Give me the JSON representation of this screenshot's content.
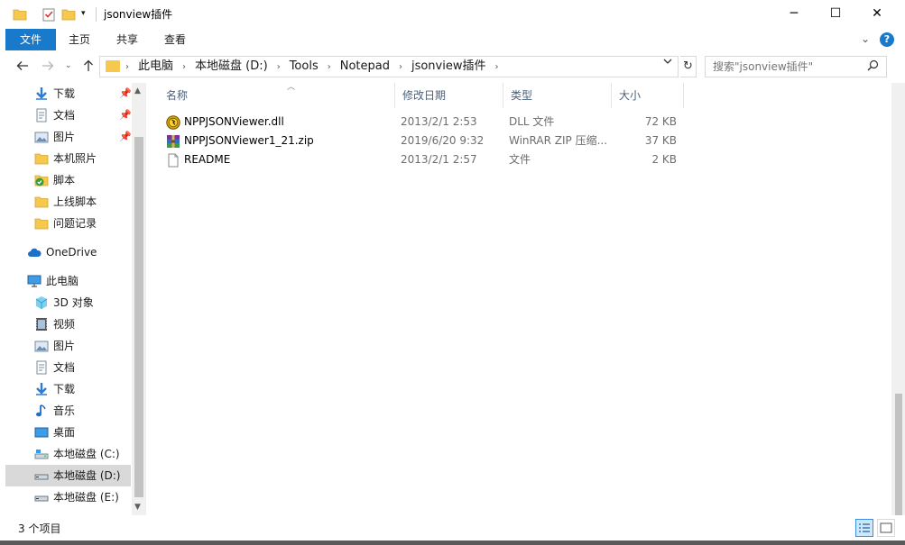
{
  "window": {
    "title": "jsonview插件",
    "minimize_glyph": "─",
    "maximize_glyph": "☐",
    "close_glyph": "✕"
  },
  "ribbon": {
    "tabs": [
      "文件",
      "主页",
      "共享",
      "查看"
    ],
    "expand_glyph": "⌄",
    "help_glyph": "?"
  },
  "address": {
    "breadcrumbs": [
      "此电脑",
      "本地磁盘 (D:)",
      "Tools",
      "Notepad",
      "jsonview插件"
    ],
    "search_placeholder": "搜索\"jsonview插件\""
  },
  "navigation": {
    "items": [
      {
        "label": "下载",
        "icon": "download-icon",
        "pinned": true
      },
      {
        "label": "文档",
        "icon": "document-icon",
        "pinned": true
      },
      {
        "label": "图片",
        "icon": "pictures-icon",
        "pinned": true
      },
      {
        "label": "本机照片",
        "icon": "folder-icon",
        "pinned": false
      },
      {
        "label": "脚本",
        "icon": "folder-check-icon",
        "pinned": false
      },
      {
        "label": "上线脚本",
        "icon": "folder-icon",
        "pinned": false
      },
      {
        "label": "问题记录",
        "icon": "folder-icon",
        "pinned": false
      },
      {
        "label": "OneDrive",
        "icon": "cloud-icon",
        "pinned": false
      },
      {
        "label": "此电脑",
        "icon": "computer-icon",
        "pinned": false
      },
      {
        "label": "3D 对象",
        "icon": "cube-icon",
        "pinned": false
      },
      {
        "label": "视频",
        "icon": "video-icon",
        "pinned": false
      },
      {
        "label": "图片",
        "icon": "pictures-icon",
        "pinned": false
      },
      {
        "label": "文档",
        "icon": "document-icon",
        "pinned": false
      },
      {
        "label": "下载",
        "icon": "download-icon",
        "pinned": false
      },
      {
        "label": "音乐",
        "icon": "music-icon",
        "pinned": false
      },
      {
        "label": "桌面",
        "icon": "desktop-icon",
        "pinned": false
      },
      {
        "label": "本地磁盘 (C:)",
        "icon": "drive-icon",
        "pinned": false
      },
      {
        "label": "本地磁盘 (D:)",
        "icon": "drive-icon",
        "pinned": false,
        "selected": true
      },
      {
        "label": "本地磁盘 (E:)",
        "icon": "drive-icon",
        "pinned": false
      }
    ]
  },
  "columns": {
    "name": "名称",
    "date": "修改日期",
    "type": "类型",
    "size": "大小"
  },
  "files": [
    {
      "name": "NPPJSONViewer.dll",
      "date": "2013/2/1 2:53",
      "type": "DLL 文件",
      "size": "72 KB",
      "icon": "dll-icon"
    },
    {
      "name": "NPPJSONViewer1_21.zip",
      "date": "2019/6/20 9:32",
      "type": "WinRAR ZIP 压缩...",
      "size": "37 KB",
      "icon": "winrar-icon"
    },
    {
      "name": "README",
      "date": "2013/2/1 2:57",
      "type": "文件",
      "size": "2 KB",
      "icon": "file-icon"
    }
  ],
  "status": {
    "item_count": "3 个项目"
  },
  "colors": {
    "accent": "#1979ca",
    "selection": "#cce8ff",
    "folder": "#f6c94e"
  }
}
